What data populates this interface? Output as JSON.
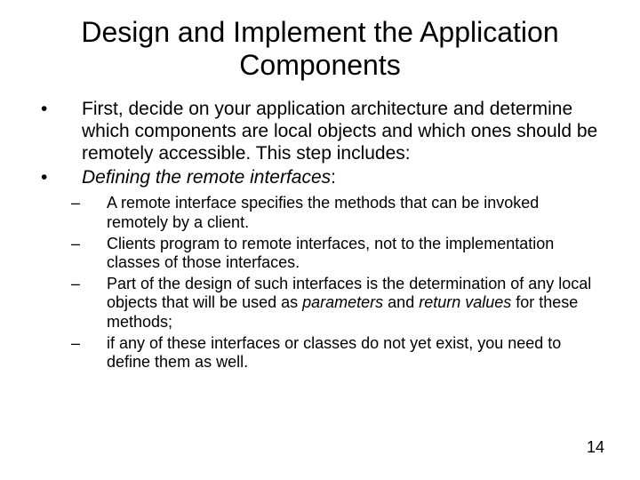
{
  "title": "Design and Implement the Application Components",
  "bullets": [
    {
      "text": "First, decide on your application architecture and determine which components are local objects and which ones should be remotely accessible. This step includes:"
    },
    {
      "html": "<span class=\"italic\">Defining the remote interfaces</span>:",
      "sub": [
        {
          "text": "A remote interface specifies the methods that can be invoked remotely by a client."
        },
        {
          "text": "Clients program to remote interfaces, not to the implementation classes of those interfaces."
        },
        {
          "html": "Part of the design of such interfaces is the determination of any local objects that will be used as <span class=\"italic\">parameters</span> and <span class=\"italic\">return values</span> for these methods;"
        },
        {
          "text": "if any of these interfaces or classes do not yet exist, you need to define them as well."
        }
      ]
    }
  ],
  "pageNumber": "14"
}
